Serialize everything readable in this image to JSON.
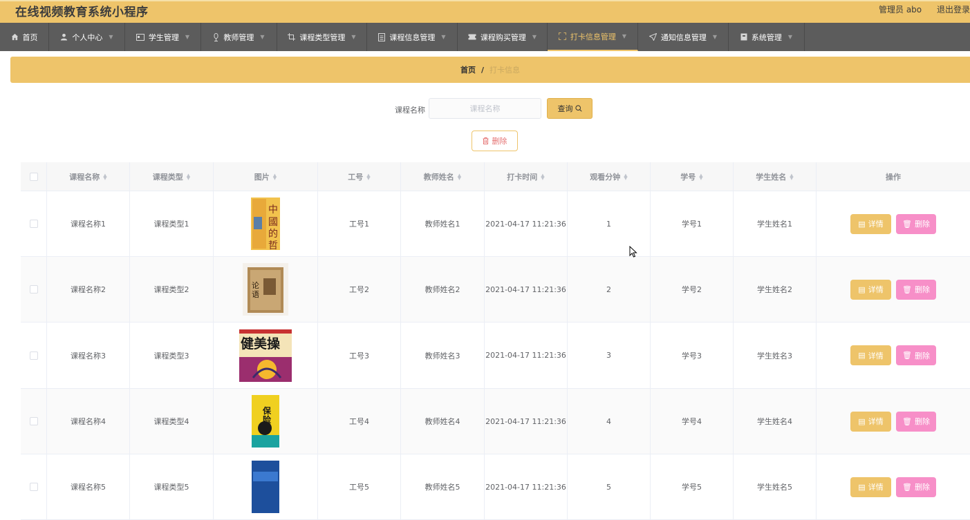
{
  "app": {
    "title": "在线视频教育系统小程序",
    "user_label": "管理员 abo",
    "logout_label": "退出登录"
  },
  "nav": {
    "items": [
      {
        "label": "首页",
        "icon": "home-icon"
      },
      {
        "label": "个人中心",
        "icon": "user-icon"
      },
      {
        "label": "学生管理",
        "icon": "id-card-icon"
      },
      {
        "label": "教师管理",
        "icon": "mic-icon"
      },
      {
        "label": "课程类型管理",
        "icon": "crop-icon"
      },
      {
        "label": "课程信息管理",
        "icon": "document-icon"
      },
      {
        "label": "课程购买管理",
        "icon": "ticket-icon"
      },
      {
        "label": "打卡信息管理",
        "icon": "full-screen-icon",
        "active": true
      },
      {
        "label": "通知信息管理",
        "icon": "send-icon"
      },
      {
        "label": "系统管理",
        "icon": "box-icon"
      }
    ]
  },
  "breadcrumb": {
    "home": "首页",
    "separator": "/",
    "current": "打卡信息"
  },
  "search": {
    "label": "课程名称",
    "placeholder": "课程名称",
    "value": "",
    "button": "查询"
  },
  "batch_delete": {
    "label": "删除"
  },
  "table": {
    "columns": [
      "课程名称",
      "课程类型",
      "图片",
      "工号",
      "教师姓名",
      "打卡时间",
      "观看分钟",
      "学号",
      "学生姓名",
      "操作"
    ],
    "detail_label": "详情",
    "delete_label": "删除",
    "rows": [
      {
        "course": "课程名称1",
        "type": "课程类型1",
        "image": "book-cover-philosophy",
        "teacher_id": "工号1",
        "teacher": "教师姓名1",
        "time": "2021-04-17 11:21:36",
        "minutes": "1",
        "student_id": "学号1",
        "student": "学生姓名1"
      },
      {
        "course": "课程名称2",
        "type": "课程类型2",
        "image": "book-cover-analects",
        "teacher_id": "工号2",
        "teacher": "教师姓名2",
        "time": "2021-04-17 11:21:36",
        "minutes": "2",
        "student_id": "学号2",
        "student": "学生姓名2"
      },
      {
        "course": "课程名称3",
        "type": "课程类型3",
        "image": "book-cover-aerobics",
        "teacher_id": "工号3",
        "teacher": "教师姓名3",
        "time": "2021-04-17 11:21:36",
        "minutes": "3",
        "student_id": "学号3",
        "student": "学生姓名3"
      },
      {
        "course": "课程名称4",
        "type": "课程类型4",
        "image": "book-cover-insurance",
        "teacher_id": "工号4",
        "teacher": "教师姓名4",
        "time": "2021-04-17 11:21:36",
        "minutes": "4",
        "student_id": "学号4",
        "student": "学生姓名4"
      },
      {
        "course": "课程名称5",
        "type": "课程类型5",
        "image": "book-cover-blue",
        "teacher_id": "工号5",
        "teacher": "教师姓名5",
        "time": "2021-04-17 11:21:36",
        "minutes": "5",
        "student_id": "学号5",
        "student": "学生姓名5"
      }
    ]
  },
  "colors": {
    "accent": "#eec46a",
    "nav_bg": "#5c5c5c",
    "delete_pink": "#f78fc8"
  }
}
